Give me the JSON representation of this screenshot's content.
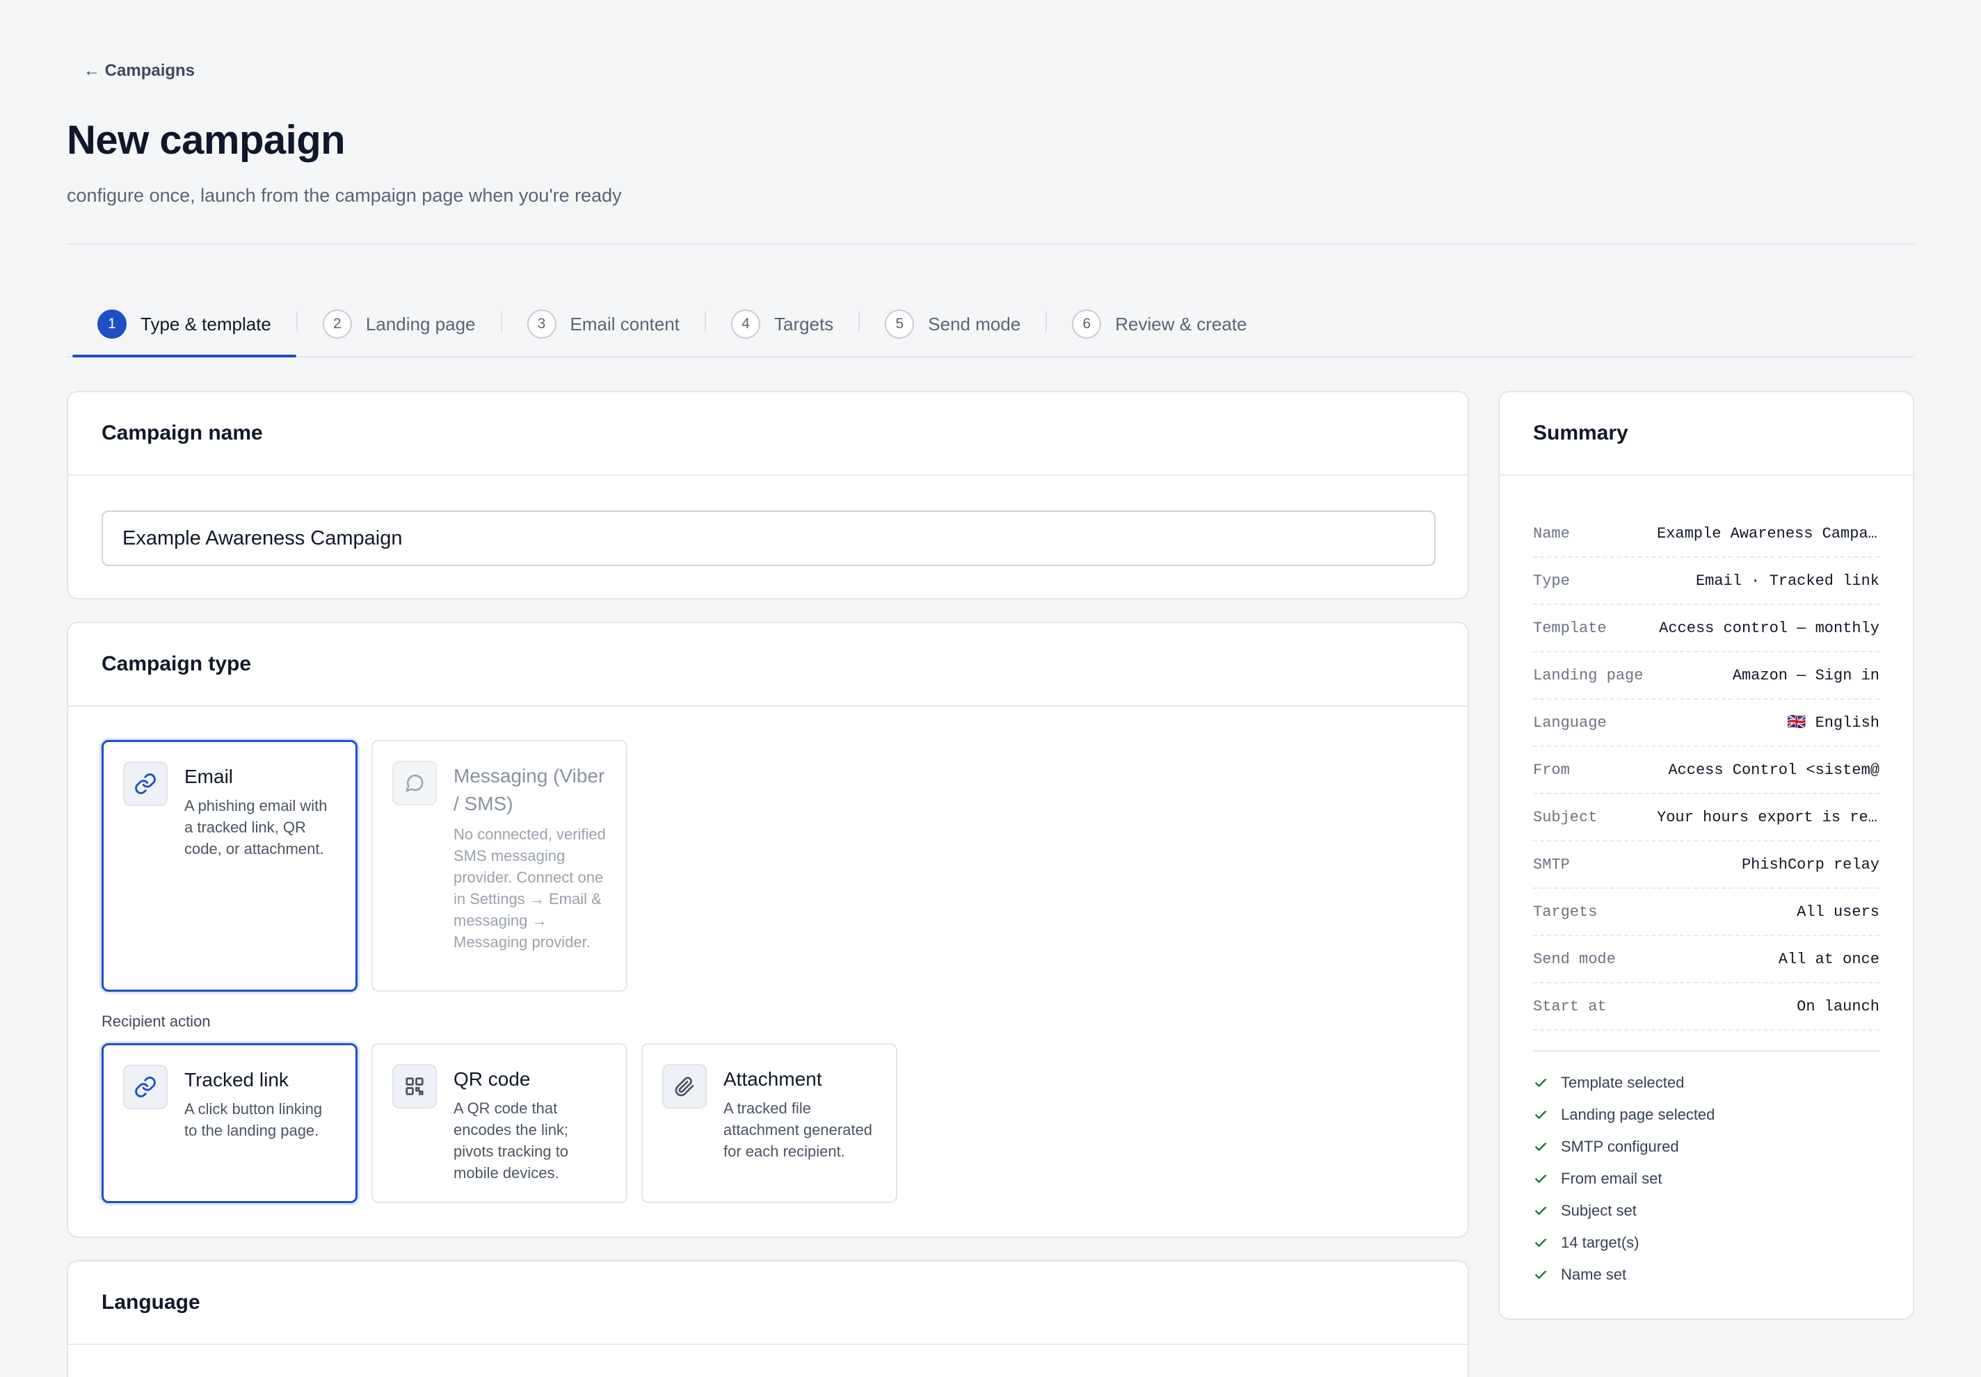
{
  "nav": {
    "back_label": "← Campaigns"
  },
  "header": {
    "title": "New campaign",
    "subtitle": "configure once, launch from the campaign page when you're ready"
  },
  "stepper": {
    "steps": [
      {
        "num": "1",
        "label": "Type & template"
      },
      {
        "num": "2",
        "label": "Landing page"
      },
      {
        "num": "3",
        "label": "Email content"
      },
      {
        "num": "4",
        "label": "Targets"
      },
      {
        "num": "5",
        "label": "Send mode"
      },
      {
        "num": "6",
        "label": "Review & create"
      }
    ],
    "active_index": 0
  },
  "campaign_name": {
    "heading": "Campaign name",
    "value": "Example Awareness Campaign"
  },
  "campaign_type": {
    "heading": "Campaign type",
    "options": [
      {
        "title": "Email",
        "desc": "A phishing email with a tracked link, QR code, or attachment.",
        "icon": "link-icon"
      },
      {
        "title": "Messaging (Viber / SMS)",
        "desc": "No connected, verified SMS messaging provider. Connect one in Settings → Email & messaging → Messaging provider.",
        "icon": "chat-bubble-icon"
      }
    ],
    "recipient_label": "Recipient action",
    "actions": [
      {
        "title": "Tracked link",
        "desc": "A click button linking to the landing page.",
        "icon": "link-icon"
      },
      {
        "title": "QR code",
        "desc": "A QR code that encodes the link; pivots tracking to mobile devices.",
        "icon": "qr-code-icon"
      },
      {
        "title": "Attachment",
        "desc": "A tracked file attachment generated for each recipient.",
        "icon": "paperclip-icon"
      }
    ]
  },
  "language": {
    "heading": "Language"
  },
  "summary": {
    "heading": "Summary",
    "rows": [
      {
        "key": "Name",
        "value": "Example Awareness Campaign"
      },
      {
        "key": "Type",
        "value": "Email · Tracked link"
      },
      {
        "key": "Template",
        "value": "Access control — monthly"
      },
      {
        "key": "Landing page",
        "value": "Amazon — Sign in"
      },
      {
        "key": "Language",
        "value": "🇬🇧 English"
      },
      {
        "key": "From",
        "value": "Access Control <sistem@"
      },
      {
        "key": "Subject",
        "value": "Your hours export is ready"
      },
      {
        "key": "SMTP",
        "value": "PhishCorp relay"
      },
      {
        "key": "Targets",
        "value": "All users"
      },
      {
        "key": "Send mode",
        "value": "All at once"
      },
      {
        "key": "Start at",
        "value": "On launch"
      }
    ],
    "checks": [
      "Template selected",
      "Landing page selected",
      "SMTP configured",
      "From email set",
      "Subject set",
      "14 target(s)",
      "Name set"
    ]
  },
  "colors": {
    "accent": "#1e4fc4",
    "check": "#15803d"
  }
}
